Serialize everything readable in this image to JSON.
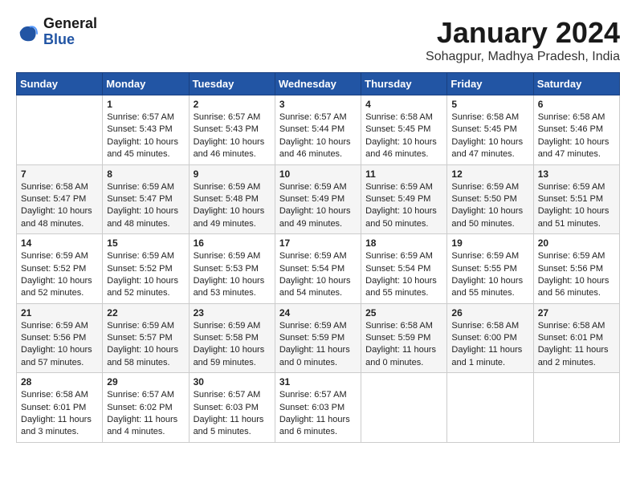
{
  "logo": {
    "line1": "General",
    "line2": "Blue"
  },
  "title": "January 2024",
  "subtitle": "Sohagpur, Madhya Pradesh, India",
  "headers": [
    "Sunday",
    "Monday",
    "Tuesday",
    "Wednesday",
    "Thursday",
    "Friday",
    "Saturday"
  ],
  "weeks": [
    [
      {
        "day": "",
        "content": ""
      },
      {
        "day": "1",
        "content": "Sunrise: 6:57 AM\nSunset: 5:43 PM\nDaylight: 10 hours\nand 45 minutes."
      },
      {
        "day": "2",
        "content": "Sunrise: 6:57 AM\nSunset: 5:43 PM\nDaylight: 10 hours\nand 46 minutes."
      },
      {
        "day": "3",
        "content": "Sunrise: 6:57 AM\nSunset: 5:44 PM\nDaylight: 10 hours\nand 46 minutes."
      },
      {
        "day": "4",
        "content": "Sunrise: 6:58 AM\nSunset: 5:45 PM\nDaylight: 10 hours\nand 46 minutes."
      },
      {
        "day": "5",
        "content": "Sunrise: 6:58 AM\nSunset: 5:45 PM\nDaylight: 10 hours\nand 47 minutes."
      },
      {
        "day": "6",
        "content": "Sunrise: 6:58 AM\nSunset: 5:46 PM\nDaylight: 10 hours\nand 47 minutes."
      }
    ],
    [
      {
        "day": "7",
        "content": "Sunrise: 6:58 AM\nSunset: 5:47 PM\nDaylight: 10 hours\nand 48 minutes."
      },
      {
        "day": "8",
        "content": "Sunrise: 6:59 AM\nSunset: 5:47 PM\nDaylight: 10 hours\nand 48 minutes."
      },
      {
        "day": "9",
        "content": "Sunrise: 6:59 AM\nSunset: 5:48 PM\nDaylight: 10 hours\nand 49 minutes."
      },
      {
        "day": "10",
        "content": "Sunrise: 6:59 AM\nSunset: 5:49 PM\nDaylight: 10 hours\nand 49 minutes."
      },
      {
        "day": "11",
        "content": "Sunrise: 6:59 AM\nSunset: 5:49 PM\nDaylight: 10 hours\nand 50 minutes."
      },
      {
        "day": "12",
        "content": "Sunrise: 6:59 AM\nSunset: 5:50 PM\nDaylight: 10 hours\nand 50 minutes."
      },
      {
        "day": "13",
        "content": "Sunrise: 6:59 AM\nSunset: 5:51 PM\nDaylight: 10 hours\nand 51 minutes."
      }
    ],
    [
      {
        "day": "14",
        "content": "Sunrise: 6:59 AM\nSunset: 5:52 PM\nDaylight: 10 hours\nand 52 minutes."
      },
      {
        "day": "15",
        "content": "Sunrise: 6:59 AM\nSunset: 5:52 PM\nDaylight: 10 hours\nand 52 minutes."
      },
      {
        "day": "16",
        "content": "Sunrise: 6:59 AM\nSunset: 5:53 PM\nDaylight: 10 hours\nand 53 minutes."
      },
      {
        "day": "17",
        "content": "Sunrise: 6:59 AM\nSunset: 5:54 PM\nDaylight: 10 hours\nand 54 minutes."
      },
      {
        "day": "18",
        "content": "Sunrise: 6:59 AM\nSunset: 5:54 PM\nDaylight: 10 hours\nand 55 minutes."
      },
      {
        "day": "19",
        "content": "Sunrise: 6:59 AM\nSunset: 5:55 PM\nDaylight: 10 hours\nand 55 minutes."
      },
      {
        "day": "20",
        "content": "Sunrise: 6:59 AM\nSunset: 5:56 PM\nDaylight: 10 hours\nand 56 minutes."
      }
    ],
    [
      {
        "day": "21",
        "content": "Sunrise: 6:59 AM\nSunset: 5:56 PM\nDaylight: 10 hours\nand 57 minutes."
      },
      {
        "day": "22",
        "content": "Sunrise: 6:59 AM\nSunset: 5:57 PM\nDaylight: 10 hours\nand 58 minutes."
      },
      {
        "day": "23",
        "content": "Sunrise: 6:59 AM\nSunset: 5:58 PM\nDaylight: 10 hours\nand 59 minutes."
      },
      {
        "day": "24",
        "content": "Sunrise: 6:59 AM\nSunset: 5:59 PM\nDaylight: 11 hours\nand 0 minutes."
      },
      {
        "day": "25",
        "content": "Sunrise: 6:58 AM\nSunset: 5:59 PM\nDaylight: 11 hours\nand 0 minutes."
      },
      {
        "day": "26",
        "content": "Sunrise: 6:58 AM\nSunset: 6:00 PM\nDaylight: 11 hours\nand 1 minute."
      },
      {
        "day": "27",
        "content": "Sunrise: 6:58 AM\nSunset: 6:01 PM\nDaylight: 11 hours\nand 2 minutes."
      }
    ],
    [
      {
        "day": "28",
        "content": "Sunrise: 6:58 AM\nSunset: 6:01 PM\nDaylight: 11 hours\nand 3 minutes."
      },
      {
        "day": "29",
        "content": "Sunrise: 6:57 AM\nSunset: 6:02 PM\nDaylight: 11 hours\nand 4 minutes."
      },
      {
        "day": "30",
        "content": "Sunrise: 6:57 AM\nSunset: 6:03 PM\nDaylight: 11 hours\nand 5 minutes."
      },
      {
        "day": "31",
        "content": "Sunrise: 6:57 AM\nSunset: 6:03 PM\nDaylight: 11 hours\nand 6 minutes."
      },
      {
        "day": "",
        "content": ""
      },
      {
        "day": "",
        "content": ""
      },
      {
        "day": "",
        "content": ""
      }
    ]
  ]
}
